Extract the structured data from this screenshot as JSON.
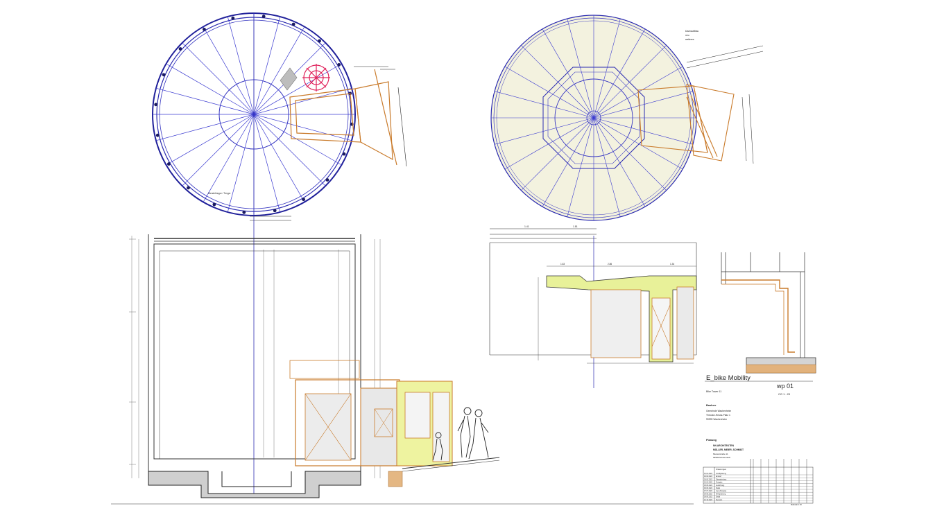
{
  "plan_left": {
    "note": "Wendeltreppe / Treppe"
  },
  "plan_right": {
    "note_lines": [
      "Dachauftbau",
      "neu",
      "weiteres"
    ],
    "dim_a": "1.41",
    "dim_b": "1.81"
  },
  "detail_section": {
    "title": "E_bike Mobility",
    "subtitle": "Bike Tower 11",
    "dims_top": [
      "1.63",
      "2.86",
      "1.34"
    ]
  },
  "title_block": {
    "plan_number": "wp 01",
    "scale": "CG  1 : 20",
    "client_label": "Bauherr",
    "client_lines": [
      "Gemeinde Wachenheim",
      "Theodor-Heuss-Platz 1",
      "99999 Wachenheim"
    ],
    "planner_label": "Planung",
    "planner_lines": [
      "NN  ARCHITEKTEN",
      "MÜLLER, MEIER, SCHMIDT",
      "Musterstraße 11",
      "99999 Musterstadt"
    ],
    "revisions_label": "Änderungen",
    "revisions": [
      {
        "date": "01.01.2022",
        "text": "Vorabplanung"
      },
      {
        "date": "02.02.2022",
        "text": "Entwurf"
      },
      {
        "date": "03.03.2022",
        "text": "Überarbeitung"
      },
      {
        "date": "04.04.2022",
        "text": "Freigabe"
      },
      {
        "date": "05.05.2022",
        "text": "Ausführung"
      },
      {
        "date": "06.06.2022",
        "text": "Statik"
      },
      {
        "date": "07.07.2022",
        "text": "Genehmigung"
      },
      {
        "date": "08.08.2022",
        "text": "Werkplanung"
      },
      {
        "date": "09.09.2022",
        "text": "Detail"
      },
      {
        "date": "10.10.2022",
        "text": "Revision"
      }
    ],
    "footer": "Maßstab 1:20"
  }
}
